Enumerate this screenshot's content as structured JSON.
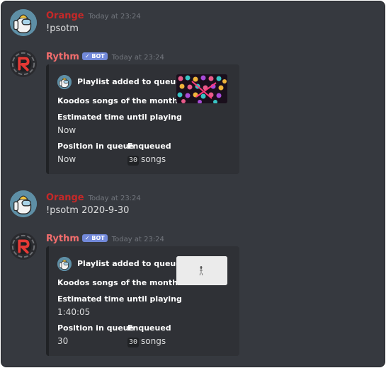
{
  "messages": [
    {
      "author": "Orange",
      "timestamp": "Today at 23:24",
      "text": "!psotm"
    },
    {
      "author": "Rythm",
      "badge": "✓ BOT",
      "timestamp": "Today at 23:24",
      "embed": {
        "author_name": "Playlist added to queue",
        "title": "Koodos songs of the month",
        "field_time_name": "Estimated time until playing",
        "field_time_value": "Now",
        "field_pos_name": "Position in queue",
        "field_pos_value": "Now",
        "field_enq_name": "Enqueued",
        "field_enq_count": "30",
        "field_enq_suffix": "songs"
      }
    },
    {
      "author": "Orange",
      "timestamp": "Today at 23:24",
      "text": "!psotm 2020-9-30"
    },
    {
      "author": "Rythm",
      "badge": "✓ BOT",
      "timestamp": "Today at 23:24",
      "embed": {
        "author_name": "Playlist added to queue",
        "title": "Koodos songs of the month",
        "field_time_name": "Estimated time until playing",
        "field_time_value": "1:40:05",
        "field_pos_name": "Position in queue",
        "field_pos_value": "30",
        "field_enq_name": "Enqueued",
        "field_enq_count": "30",
        "field_enq_suffix": "songs"
      }
    }
  ],
  "colors": {
    "background": "#36393f",
    "embed": "#2f3136",
    "orange_name": "#c62828",
    "rythm_name": "#f26d6d",
    "bot_badge": "#7289da"
  }
}
